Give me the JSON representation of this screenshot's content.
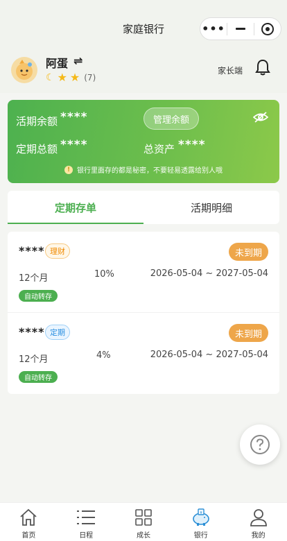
{
  "app": {
    "title": "家庭银行"
  },
  "user": {
    "name": "阿蛋",
    "star_count": "(7)",
    "parent_link": "家长端"
  },
  "balance": {
    "current_label": "活期余额",
    "current_value": "****",
    "manage_label": "管理余额",
    "fixed_label": "定期总额",
    "fixed_value": "****",
    "total_label": "总资产",
    "total_value": "****",
    "tip": "银行里面存的都是秘密，不要轻易透露给别人哦"
  },
  "tabs": [
    {
      "label": "定期存单",
      "active": true
    },
    {
      "label": "活期明细",
      "active": false
    }
  ],
  "deposits": [
    {
      "amount": "****",
      "tag": "理财",
      "status": "未到期",
      "term": "12个月",
      "rate": "10%",
      "period": "2026-05-04 ~ 2027-05-04",
      "auto": "自动转存"
    },
    {
      "amount": "****",
      "tag": "定期",
      "status": "未到期",
      "term": "12个月",
      "rate": "4%",
      "period": "2026-05-04 ~ 2027-05-04",
      "auto": "自动转存"
    }
  ],
  "nav": [
    {
      "label": "首页",
      "icon": "home-icon"
    },
    {
      "label": "日程",
      "icon": "list-icon"
    },
    {
      "label": "成长",
      "icon": "grid-icon"
    },
    {
      "label": "银行",
      "icon": "piggy-bank-icon"
    },
    {
      "label": "我的",
      "icon": "user-icon"
    }
  ],
  "colors": {
    "accent": "#4caf50",
    "status": "#eea64a",
    "card_start": "#4db14f",
    "card_end": "#8cc94a"
  }
}
